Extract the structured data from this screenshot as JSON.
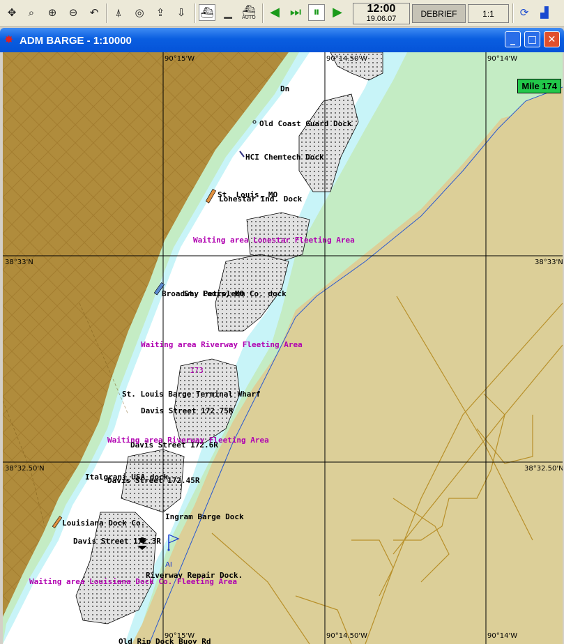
{
  "toolbar": {
    "icons": [
      "zoom-fit-icon",
      "zoom-window-icon",
      "zoom-in-icon",
      "zoom-out-icon",
      "undo-icon",
      "route-icon",
      "target-icon",
      "export-icon",
      "import-icon",
      "ship-mode-icon",
      "barge-icon",
      "auto-icon",
      "play-back-icon",
      "step-forward-icon",
      "pause-icon",
      "play-icon",
      "mode-icon",
      "chart-icon"
    ],
    "auto_label": "AUTO",
    "clock_time": "12:00",
    "clock_date": "19.06.07",
    "debrief_label": "DEBRIEF",
    "scale_label": "1:1"
  },
  "window": {
    "title": "ADM BARGE - 1:10000",
    "minimize": "_",
    "maximize": "□",
    "close": "✕"
  },
  "chart": {
    "colors": {
      "land": "#dccf98",
      "bank": "#b08c3c",
      "shallow": "#c4ecc4",
      "channel": "#c8f4f8",
      "water": "#ffffff",
      "grid": "#000000",
      "waiting": "#b000b0",
      "mile_badge": "#22c84a"
    },
    "coord_labels": {
      "top": [
        "90°15'W",
        "90°14.50'W",
        "90°14'W"
      ],
      "bottom": [
        "90°15'W",
        "90°14.50'W",
        "90°14'W"
      ],
      "left": [
        "38°33'N",
        "38°32.50'N"
      ],
      "right": [
        "38°33'N",
        "38°32.50'N"
      ]
    },
    "mile_marker": "Mile 174",
    "mile_173": "173",
    "labels": [
      "Dn",
      "Old Coast Guard Dock",
      "HCI Chemtech Dock",
      "St. Louis, MO",
      "Lonestar Ind. Dock",
      "St. Louis, MO",
      "Broadway Petroleum Co. dock",
      "St. Louis Barge Terminal Wharf",
      "Davis Street 172.75R",
      "Davis Street 172.6R",
      "Italgrani USA dock",
      "Davis Street 172.45R",
      "Louisiana Dock Co.",
      "Ingram Barge Dock",
      "Davis Street 172.3R",
      "Riverway Repair Dock.",
      "Old Rip Dock Buoy Rd"
    ],
    "waiting_areas": [
      "Waiting area Lonestar Fleeting Area",
      "Waiting area Riverway Fleeting Area",
      "Waiting area Riverway Fleeting Area",
      "Waiting area Louisiana Dock Co. Fleeting Area"
    ],
    "flag_label": "AI"
  }
}
